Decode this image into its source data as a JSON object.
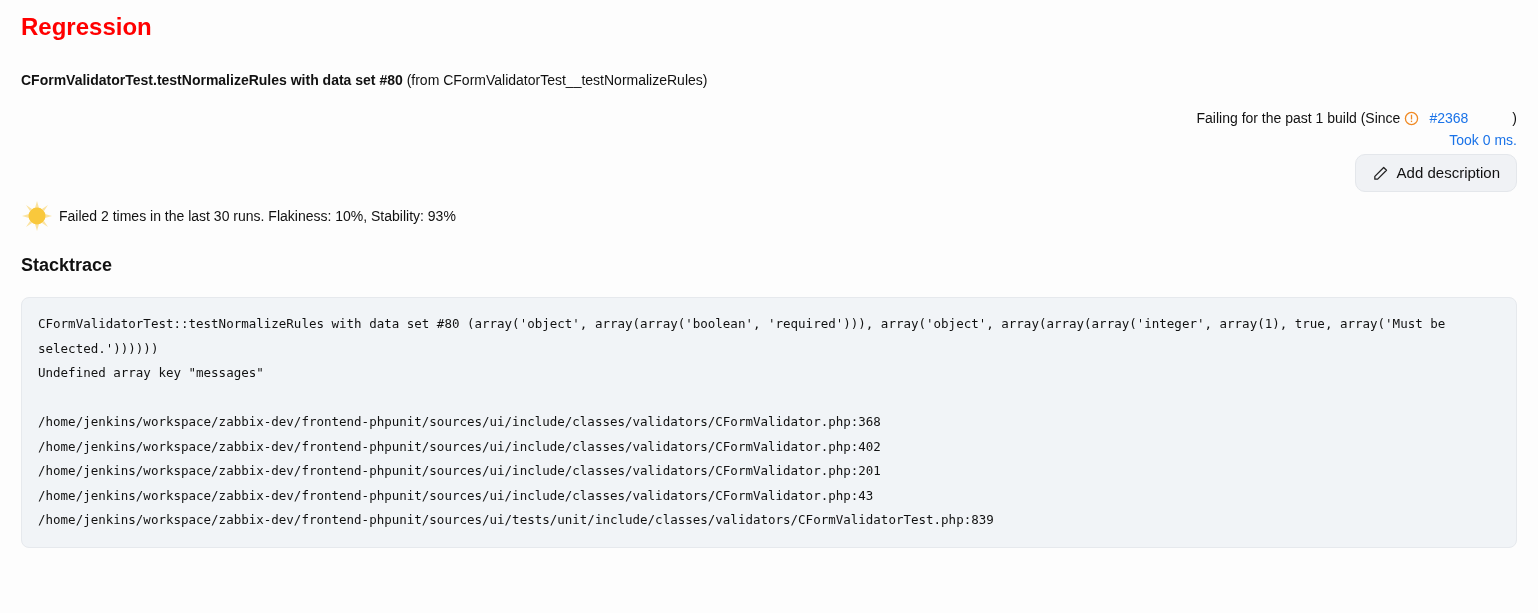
{
  "title": "Regression",
  "test_name": "**CFormValidatorTest.testNormalizeRules with data set #80** (from CFormValidatorTest__testNormalizeRules)",
  "failing": {
    "text": "Failing for the past 1 build (Since",
    "build_link": "#2368",
    "close": ")"
  },
  "took": "Took 0 ms.",
  "add_description": "Add description",
  "health": "Failed 2 times in the last 30 runs. Flakiness: 10%, Stability: 93%",
  "stacktrace_heading": "Stacktrace",
  "stacktrace": {
    "message": [
      "CFormValidatorTest::testNormalizeRules with data set #80 (array('object', array(array('boolean', 'required'))), array('object', array(array(array('integer', array(1), true, array('Must be selected.'))))))",
      "Undefined array key \"messages\""
    ],
    "frames": [
      "/home/jenkins/workspace/zabbix-dev/frontend-phpunit/sources/ui/include/classes/validators/CFormValidator.php:368",
      "/home/jenkins/workspace/zabbix-dev/frontend-phpunit/sources/ui/include/classes/validators/CFormValidator.php:402",
      "/home/jenkins/workspace/zabbix-dev/frontend-phpunit/sources/ui/include/classes/validators/CFormValidator.php:201",
      "/home/jenkins/workspace/zabbix-dev/frontend-phpunit/sources/ui/include/classes/validators/CFormValidator.php:43",
      "/home/jenkins/workspace/zabbix-dev/frontend-phpunit/sources/ui/tests/unit/include/classes/validators/CFormValidatorTest.php:839"
    ]
  }
}
